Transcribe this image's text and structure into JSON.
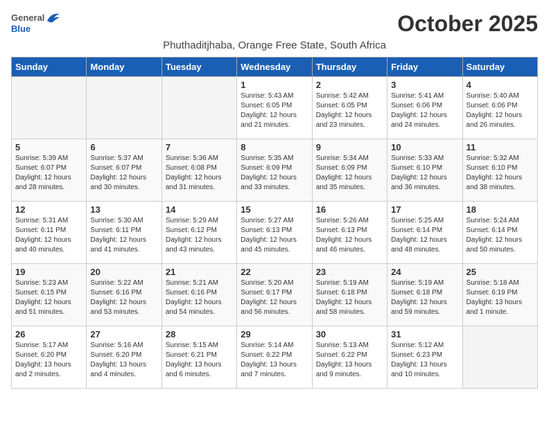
{
  "logo": {
    "general": "General",
    "blue": "Blue"
  },
  "title": "October 2025",
  "location": "Phuthaditjhaba, Orange Free State, South Africa",
  "days_of_week": [
    "Sunday",
    "Monday",
    "Tuesday",
    "Wednesday",
    "Thursday",
    "Friday",
    "Saturday"
  ],
  "weeks": [
    [
      {
        "day": "",
        "sunrise": "",
        "sunset": "",
        "daylight": ""
      },
      {
        "day": "",
        "sunrise": "",
        "sunset": "",
        "daylight": ""
      },
      {
        "day": "",
        "sunrise": "",
        "sunset": "",
        "daylight": ""
      },
      {
        "day": "1",
        "sunrise": "Sunrise: 5:43 AM",
        "sunset": "Sunset: 6:05 PM",
        "daylight": "Daylight: 12 hours and 21 minutes."
      },
      {
        "day": "2",
        "sunrise": "Sunrise: 5:42 AM",
        "sunset": "Sunset: 6:05 PM",
        "daylight": "Daylight: 12 hours and 23 minutes."
      },
      {
        "day": "3",
        "sunrise": "Sunrise: 5:41 AM",
        "sunset": "Sunset: 6:06 PM",
        "daylight": "Daylight: 12 hours and 24 minutes."
      },
      {
        "day": "4",
        "sunrise": "Sunrise: 5:40 AM",
        "sunset": "Sunset: 6:06 PM",
        "daylight": "Daylight: 12 hours and 26 minutes."
      }
    ],
    [
      {
        "day": "5",
        "sunrise": "Sunrise: 5:39 AM",
        "sunset": "Sunset: 6:07 PM",
        "daylight": "Daylight: 12 hours and 28 minutes."
      },
      {
        "day": "6",
        "sunrise": "Sunrise: 5:37 AM",
        "sunset": "Sunset: 6:07 PM",
        "daylight": "Daylight: 12 hours and 30 minutes."
      },
      {
        "day": "7",
        "sunrise": "Sunrise: 5:36 AM",
        "sunset": "Sunset: 6:08 PM",
        "daylight": "Daylight: 12 hours and 31 minutes."
      },
      {
        "day": "8",
        "sunrise": "Sunrise: 5:35 AM",
        "sunset": "Sunset: 6:09 PM",
        "daylight": "Daylight: 12 hours and 33 minutes."
      },
      {
        "day": "9",
        "sunrise": "Sunrise: 5:34 AM",
        "sunset": "Sunset: 6:09 PM",
        "daylight": "Daylight: 12 hours and 35 minutes."
      },
      {
        "day": "10",
        "sunrise": "Sunrise: 5:33 AM",
        "sunset": "Sunset: 6:10 PM",
        "daylight": "Daylight: 12 hours and 36 minutes."
      },
      {
        "day": "11",
        "sunrise": "Sunrise: 5:32 AM",
        "sunset": "Sunset: 6:10 PM",
        "daylight": "Daylight: 12 hours and 38 minutes."
      }
    ],
    [
      {
        "day": "12",
        "sunrise": "Sunrise: 5:31 AM",
        "sunset": "Sunset: 6:11 PM",
        "daylight": "Daylight: 12 hours and 40 minutes."
      },
      {
        "day": "13",
        "sunrise": "Sunrise: 5:30 AM",
        "sunset": "Sunset: 6:11 PM",
        "daylight": "Daylight: 12 hours and 41 minutes."
      },
      {
        "day": "14",
        "sunrise": "Sunrise: 5:29 AM",
        "sunset": "Sunset: 6:12 PM",
        "daylight": "Daylight: 12 hours and 43 minutes."
      },
      {
        "day": "15",
        "sunrise": "Sunrise: 5:27 AM",
        "sunset": "Sunset: 6:13 PM",
        "daylight": "Daylight: 12 hours and 45 minutes."
      },
      {
        "day": "16",
        "sunrise": "Sunrise: 5:26 AM",
        "sunset": "Sunset: 6:13 PM",
        "daylight": "Daylight: 12 hours and 46 minutes."
      },
      {
        "day": "17",
        "sunrise": "Sunrise: 5:25 AM",
        "sunset": "Sunset: 6:14 PM",
        "daylight": "Daylight: 12 hours and 48 minutes."
      },
      {
        "day": "18",
        "sunrise": "Sunrise: 5:24 AM",
        "sunset": "Sunset: 6:14 PM",
        "daylight": "Daylight: 12 hours and 50 minutes."
      }
    ],
    [
      {
        "day": "19",
        "sunrise": "Sunrise: 5:23 AM",
        "sunset": "Sunset: 6:15 PM",
        "daylight": "Daylight: 12 hours and 51 minutes."
      },
      {
        "day": "20",
        "sunrise": "Sunrise: 5:22 AM",
        "sunset": "Sunset: 6:16 PM",
        "daylight": "Daylight: 12 hours and 53 minutes."
      },
      {
        "day": "21",
        "sunrise": "Sunrise: 5:21 AM",
        "sunset": "Sunset: 6:16 PM",
        "daylight": "Daylight: 12 hours and 54 minutes."
      },
      {
        "day": "22",
        "sunrise": "Sunrise: 5:20 AM",
        "sunset": "Sunset: 6:17 PM",
        "daylight": "Daylight: 12 hours and 56 minutes."
      },
      {
        "day": "23",
        "sunrise": "Sunrise: 5:19 AM",
        "sunset": "Sunset: 6:18 PM",
        "daylight": "Daylight: 12 hours and 58 minutes."
      },
      {
        "day": "24",
        "sunrise": "Sunrise: 5:19 AM",
        "sunset": "Sunset: 6:18 PM",
        "daylight": "Daylight: 12 hours and 59 minutes."
      },
      {
        "day": "25",
        "sunrise": "Sunrise: 5:18 AM",
        "sunset": "Sunset: 6:19 PM",
        "daylight": "Daylight: 13 hours and 1 minute."
      }
    ],
    [
      {
        "day": "26",
        "sunrise": "Sunrise: 5:17 AM",
        "sunset": "Sunset: 6:20 PM",
        "daylight": "Daylight: 13 hours and 2 minutes."
      },
      {
        "day": "27",
        "sunrise": "Sunrise: 5:16 AM",
        "sunset": "Sunset: 6:20 PM",
        "daylight": "Daylight: 13 hours and 4 minutes."
      },
      {
        "day": "28",
        "sunrise": "Sunrise: 5:15 AM",
        "sunset": "Sunset: 6:21 PM",
        "daylight": "Daylight: 13 hours and 6 minutes."
      },
      {
        "day": "29",
        "sunrise": "Sunrise: 5:14 AM",
        "sunset": "Sunset: 6:22 PM",
        "daylight": "Daylight: 13 hours and 7 minutes."
      },
      {
        "day": "30",
        "sunrise": "Sunrise: 5:13 AM",
        "sunset": "Sunset: 6:22 PM",
        "daylight": "Daylight: 13 hours and 9 minutes."
      },
      {
        "day": "31",
        "sunrise": "Sunrise: 5:12 AM",
        "sunset": "Sunset: 6:23 PM",
        "daylight": "Daylight: 13 hours and 10 minutes."
      },
      {
        "day": "",
        "sunrise": "",
        "sunset": "",
        "daylight": ""
      }
    ]
  ]
}
